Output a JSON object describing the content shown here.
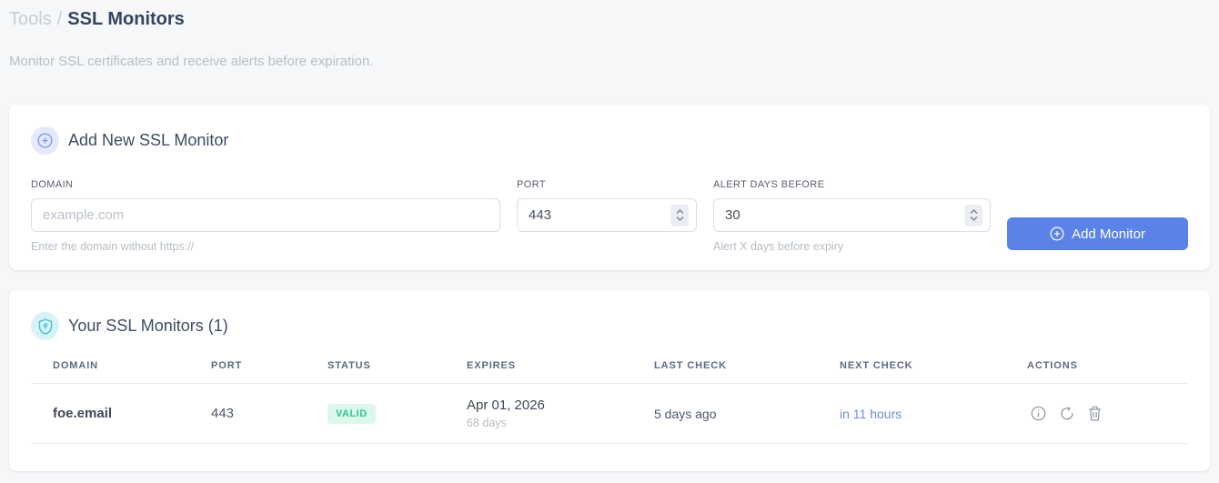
{
  "breadcrumb": {
    "section": "Tools",
    "separator": "/",
    "page": "SSL Monitors"
  },
  "subtitle": "Monitor SSL certificates and receive alerts before expiration.",
  "add_card": {
    "title": "Add New SSL Monitor",
    "icon": "plus-circle-icon",
    "fields": {
      "domain": {
        "label": "DOMAIN",
        "placeholder": "example.com",
        "value": "",
        "helper": "Enter the domain without https://"
      },
      "port": {
        "label": "PORT",
        "value": "443"
      },
      "alert_days": {
        "label": "ALERT DAYS BEFORE",
        "value": "30",
        "helper": "Alert X days before expiry"
      }
    },
    "submit_label": "Add Monitor",
    "submit_icon": "plus-circle-icon"
  },
  "monitors_card": {
    "title": "Your SSL Monitors (1)",
    "icon": "shield-icon",
    "table": {
      "headers": [
        "DOMAIN",
        "PORT",
        "STATUS",
        "EXPIRES",
        "LAST CHECK",
        "NEXT CHECK",
        "ACTIONS"
      ],
      "rows": [
        {
          "domain": "foe.email",
          "port": "443",
          "status": "VALID",
          "expires_date": "Apr 01, 2026",
          "expires_days": "68 days",
          "last_check": "5 days ago",
          "next_check": "in 11 hours",
          "actions": [
            "info-icon",
            "refresh-icon",
            "trash-icon"
          ]
        }
      ]
    }
  },
  "colors": {
    "accent_blue": "#5b82e8",
    "link_blue": "#6b8ceb",
    "valid_text": "#2bc98c",
    "valid_bg": "#dcf8ea",
    "teal_icon": "#35c4d8",
    "page_bg": "#f6f7f9"
  }
}
